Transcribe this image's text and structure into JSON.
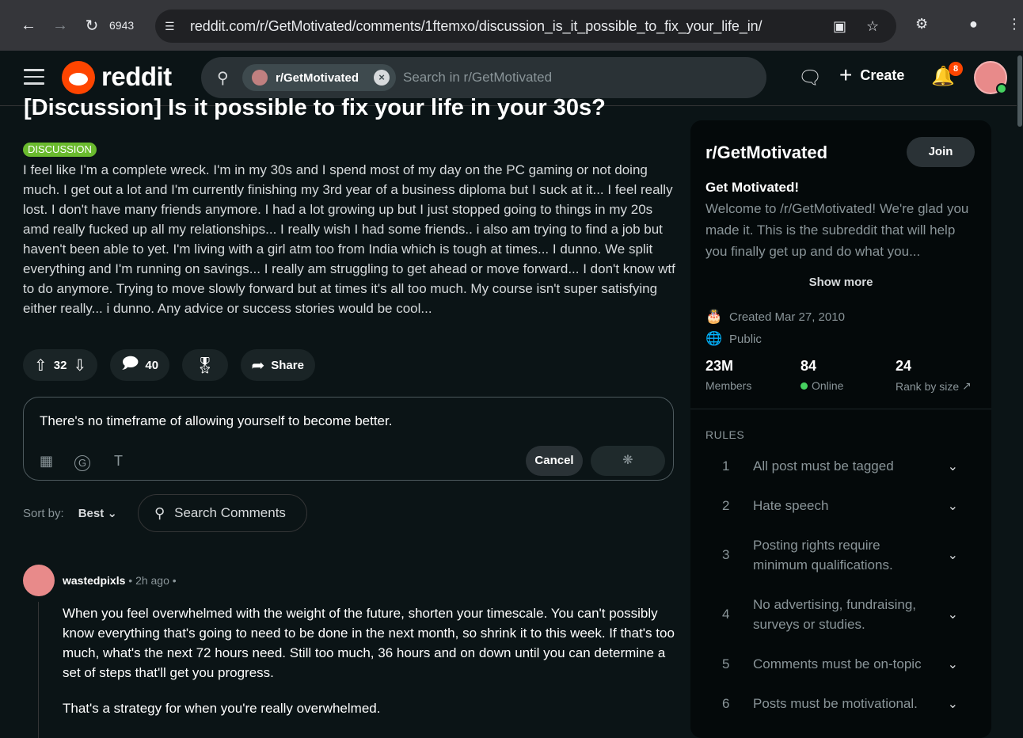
{
  "browser": {
    "tab_count": "6943",
    "url": "reddit.com/r/GetMotivated/comments/1ftemxo/discussion_is_it_possible_to_fix_your_life_in/"
  },
  "header": {
    "logo_text": "reddit",
    "search_chip": "r/GetMotivated",
    "search_placeholder": "Search in r/GetMotivated",
    "create_label": "Create",
    "notif_count": "8"
  },
  "post": {
    "title": "[Discussion] Is it possible to fix your life in your 30s?",
    "flair": "DISCUSSION",
    "body": "I feel like I'm a complete wreck. I'm in my 30s and I spend most of my day on the PC gaming or not doing much. I get out a lot and I'm currently finishing my 3rd year of a business diploma but I suck at it... I feel really lost. I don't have many friends anymore. I had a lot growing up but I just stopped going to things in my 20s amd really fucked up all my relationships... I really wish I had some friends.. i also am trying to find a job but haven't been able to yet. I'm living with a girl atm too from India which is tough at times... I dunno. We split everything and I'm running on savings... I really am struggling to get ahead or move forward... I don't know wtf to do anymore. Trying to move slowly forward but at times it's all too much. My course isn't super satisfying either really... i dunno. Any advice or success stories would be cool...",
    "votes": "32",
    "comments": "40",
    "share_label": "Share"
  },
  "composer": {
    "text": "There's no timeframe of allowing yourself to become better.",
    "cancel_label": "Cancel"
  },
  "sort": {
    "label": "Sort by:",
    "value": "Best",
    "search_label": "Search Comments"
  },
  "comment": {
    "author": "wastedpixls",
    "time": "2h ago",
    "paragraphs": [
      "When you feel overwhelmed with the weight of the future, shorten your timescale. You can't possibly know everything that's going to need to be done in the next month, so shrink it to this week. If that's too much, what's the next 72 hours need. Still too much, 36 hours and on down until you can determine a set of steps that'll get you progress.",
      "That's a strategy for when you're really overwhelmed."
    ]
  },
  "sidebar": {
    "name": "r/GetMotivated",
    "join_label": "Join",
    "tagline": "Get Motivated!",
    "description": "Welcome to /r/GetMotivated! We're glad you made it. This is the subreddit that will help you finally get up and do what you...",
    "show_more": "Show more",
    "created": "Created Mar 27, 2010",
    "visibility": "Public",
    "members_num": "23M",
    "members_label": "Members",
    "online_num": "84",
    "online_label": "Online",
    "rank_num": "24",
    "rank_label": "Rank by size",
    "rules_title": "RULES",
    "rules": [
      {
        "n": "1",
        "text": "All post must be tagged"
      },
      {
        "n": "2",
        "text": "Hate speech"
      },
      {
        "n": "3",
        "text": "Posting rights require minimum qualifications."
      },
      {
        "n": "4",
        "text": "No advertising, fundraising, surveys or studies."
      },
      {
        "n": "5",
        "text": "Comments must be on-topic"
      },
      {
        "n": "6",
        "text": "Posts must be motivational."
      }
    ]
  },
  "colors": {
    "accent": "#ff4500",
    "flair": "#6aba2e",
    "online": "#46d160"
  }
}
